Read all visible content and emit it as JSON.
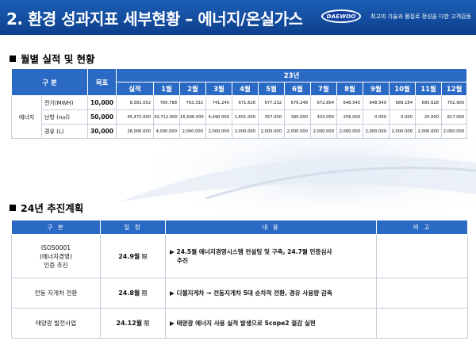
{
  "header": {
    "title": "2. 환경 성과지표 세부현황 – 에너지/온실가스",
    "logo_text": "DAEWOO",
    "slogan": "최고의 기술과 품질로  정성을 다한 고객감동"
  },
  "section1": {
    "title": "월별 실적 및 현황",
    "table": {
      "head_category": "구 분",
      "head_target": "목표",
      "head_year": "23년",
      "head_actual": "실적",
      "months": [
        "1월",
        "2월",
        "3월",
        "4월",
        "5월",
        "6월",
        "7월",
        "8월",
        "9월",
        "10월",
        "11월",
        "12월"
      ],
      "group_label": "에너지",
      "rows": [
        {
          "item": "전기(MWH)",
          "target": "10,000",
          "actual": "8,381.052",
          "monthly": [
            "760.788",
            "793.332",
            "741.240",
            "671.616",
            "677.232",
            "679.248",
            "672.804",
            "648.540",
            "648.540",
            "689.184",
            "695.628",
            "702.900"
          ]
        },
        {
          "item": "난방 (n㎥)",
          "target": "50,000",
          "actual": "45,472.000",
          "monthly": [
            "20,712.000",
            "16,596.000",
            "4,490.000",
            "1,601.000",
            "357.000",
            "390.000",
            "433.000",
            "256.000",
            "0.000",
            "0.000",
            "20.000",
            "617.000"
          ]
        },
        {
          "item": "경유 (L)",
          "target": "30,000",
          "actual": "26,000.000",
          "monthly": [
            "4,000.000",
            "2,000.000",
            "2,000.000",
            "2,000.000",
            "2,000.000",
            "2,000.000",
            "2,000.000",
            "2,000.000",
            "2,000.000",
            "2,000.000",
            "2,000.000",
            "2,000.000"
          ]
        }
      ]
    }
  },
  "section2": {
    "title": "24년 추진계획",
    "table": {
      "headers": [
        "구 분",
        "일 정",
        "내 용",
        "비 고"
      ],
      "rows": [
        {
          "category_lines": [
            "ISO50001",
            "(에너지경영)",
            "인증 추진"
          ],
          "schedule": "24.9월",
          "limit": "限",
          "content_lines": [
            "▶ 24.5월 에너지경영시스템 컨설팅 및 구축, 24.7월 인증심사",
            "추진"
          ],
          "note": ""
        },
        {
          "category_lines": [
            "전동 지게차 전환"
          ],
          "schedule": "24.8월",
          "limit": "限",
          "content_lines": [
            "▶ 디젤지게차 → 전동지게차 5대 순차적 전환, 경유 사용량 감축"
          ],
          "note": ""
        },
        {
          "category_lines": [
            "태양광 발전사업"
          ],
          "schedule": "24.12월",
          "limit": "限",
          "content_lines": [
            "▶ 태양광 에너지 사용 실적 발생으로 Scope2 절감 실현"
          ],
          "note": ""
        }
      ]
    }
  },
  "colors": {
    "header_blue": "#0d3f8c",
    "table_head_blue": "#2a69c4"
  }
}
